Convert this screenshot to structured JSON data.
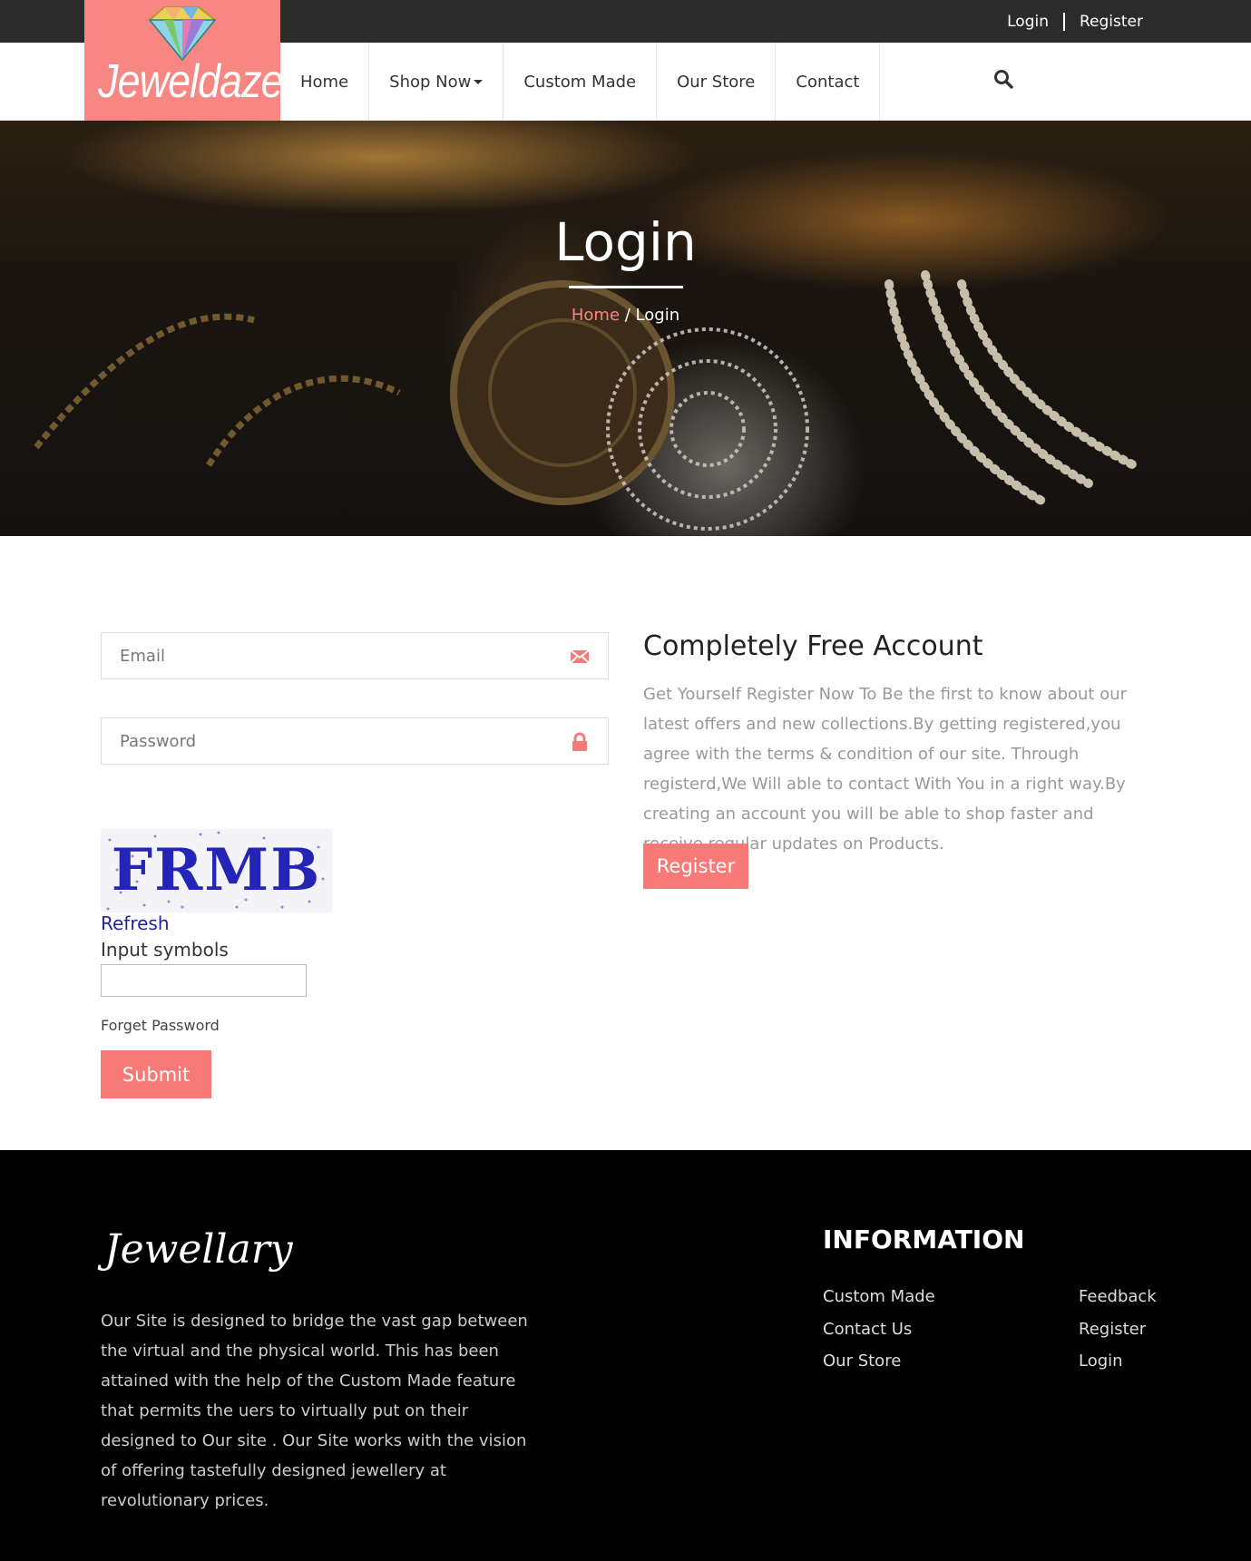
{
  "topbar": {
    "login": "Login",
    "register": "Register"
  },
  "logo": {
    "text": "Jeweldaze"
  },
  "nav": {
    "home": "Home",
    "shop_now": "Shop Now",
    "custom_made": "Custom Made",
    "our_store": "Our Store",
    "contact": "Contact"
  },
  "hero": {
    "title": "Login",
    "breadcrumb_home": "Home",
    "breadcrumb_sep": " / ",
    "breadcrumb_current": "Login"
  },
  "form": {
    "email_placeholder": "Email",
    "password_placeholder": "Password",
    "refresh": "Refresh",
    "input_symbols": "Input symbols",
    "forget_password": "Forget Password",
    "submit": "Submit"
  },
  "register_box": {
    "title": "Completely Free Account",
    "text": "Get Yourself Register Now To Be the first to know about our latest offers and new collections.By getting registered,you agree with the terms & condition of our site. Through registerd,We Will able to contact With You in a right way.By creating an account you will be able to shop faster and receive regular updates on Products.",
    "button": "Register"
  },
  "footer": {
    "logo_text": "Jewellary",
    "about": "Our Site is designed to bridge the vast gap between the virtual and the physical world. This has been attained with the help of the Custom Made feature that permits the uers to virtually put on their designed to Our site . Our Site works with the vision of offering tastefully designed jewellery at revolutionary prices.",
    "info_title": "INFORMATION",
    "col1": [
      "Custom Made",
      "Contact Us",
      "Our Store"
    ],
    "col2": [
      "Feedback",
      "Register",
      "Login"
    ]
  },
  "colors": {
    "accent": "#f88683",
    "button": "#f87a78",
    "topbar": "#2b2b2b",
    "footer": "#000000"
  }
}
